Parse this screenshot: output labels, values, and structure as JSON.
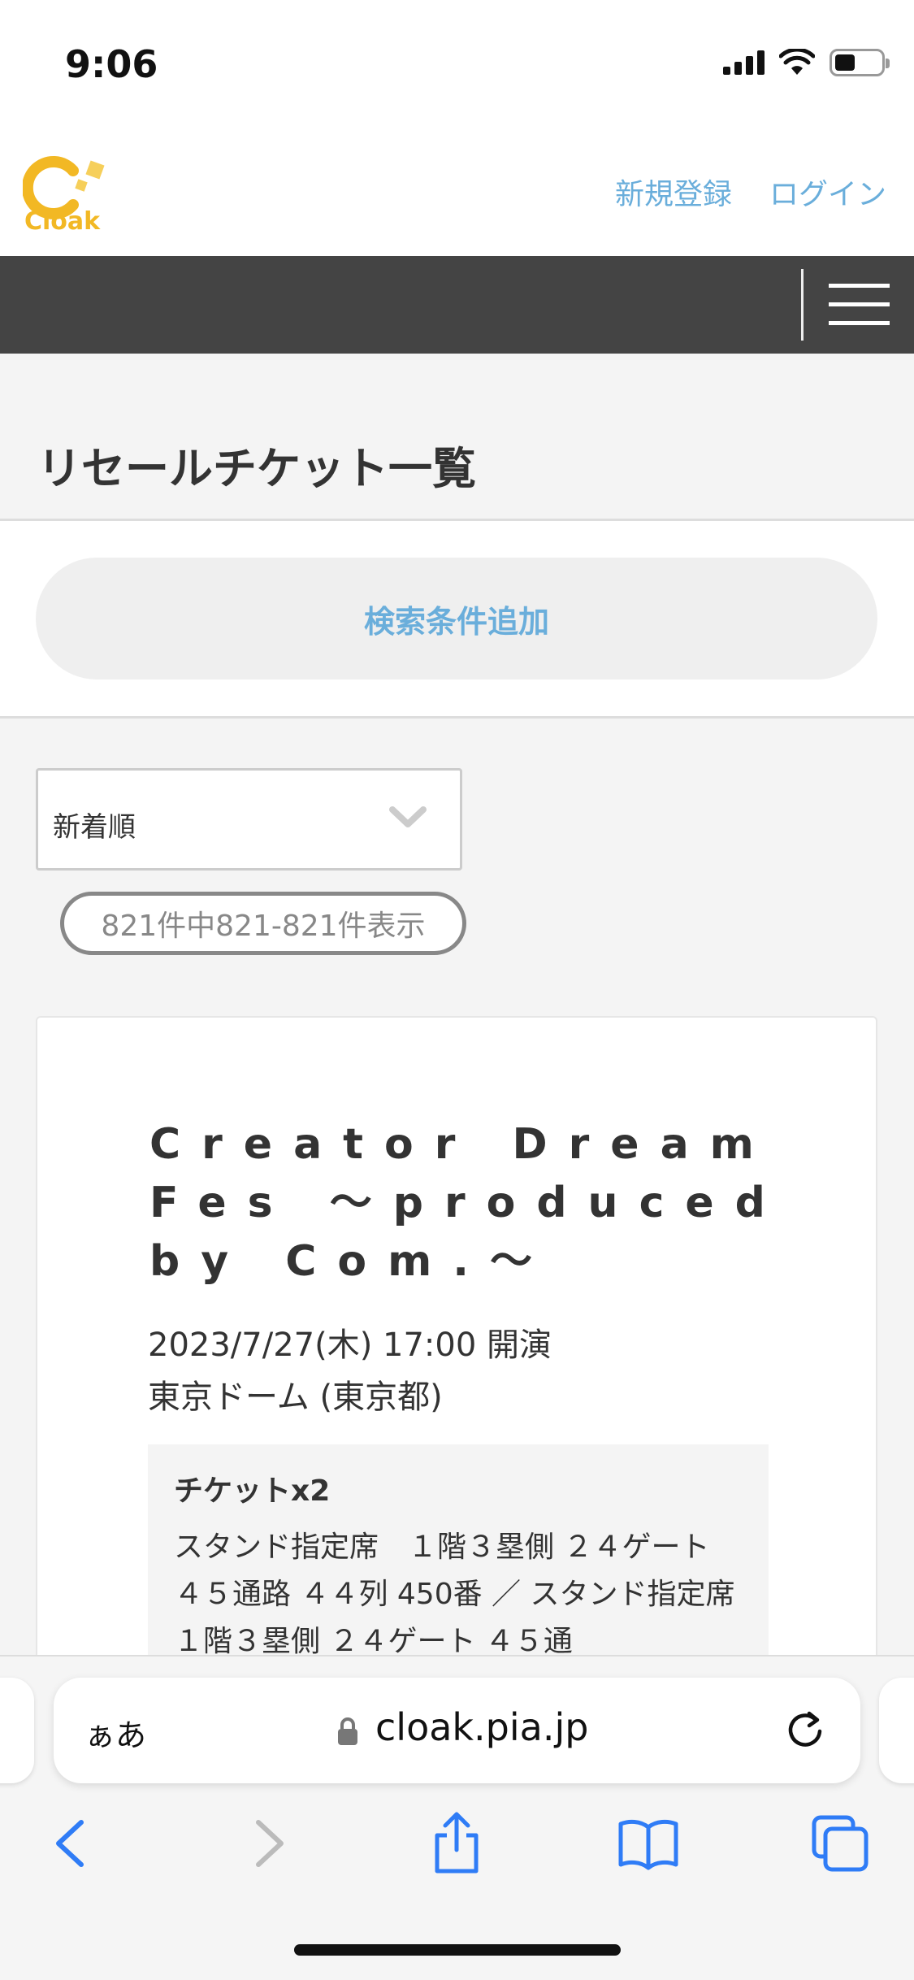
{
  "status_bar": {
    "time": "9:06"
  },
  "header": {
    "logo_text": "Cloak",
    "register_label": "新規登録",
    "login_label": "ログイン"
  },
  "page": {
    "title": "リセールチケット一覧",
    "search_button_label": "検索条件追加",
    "sort_selected": "新着順",
    "result_count": "821件中821-821件表示"
  },
  "listing": {
    "event_title": "Creator Dream Fes ～produced by Com.～",
    "date": "2023/7/27(木) 17:00 開演",
    "venue": "東京ドーム (東京都)",
    "ticket_count": "チケットx2",
    "seat_info": "スタンド指定席　１階３塁側 ２４ゲート ４５通路 ４４列 450番 ／ スタンド指定席　１階３塁側 ２４ゲート ４５通"
  },
  "browser": {
    "text_size_label": "ぁあ",
    "url": "cloak.pia.jp"
  },
  "colors": {
    "accent_blue": "#6aaedb",
    "logo_yellow": "#f2b824",
    "nav_dark": "#444444",
    "safari_blue": "#2f7cf6"
  }
}
